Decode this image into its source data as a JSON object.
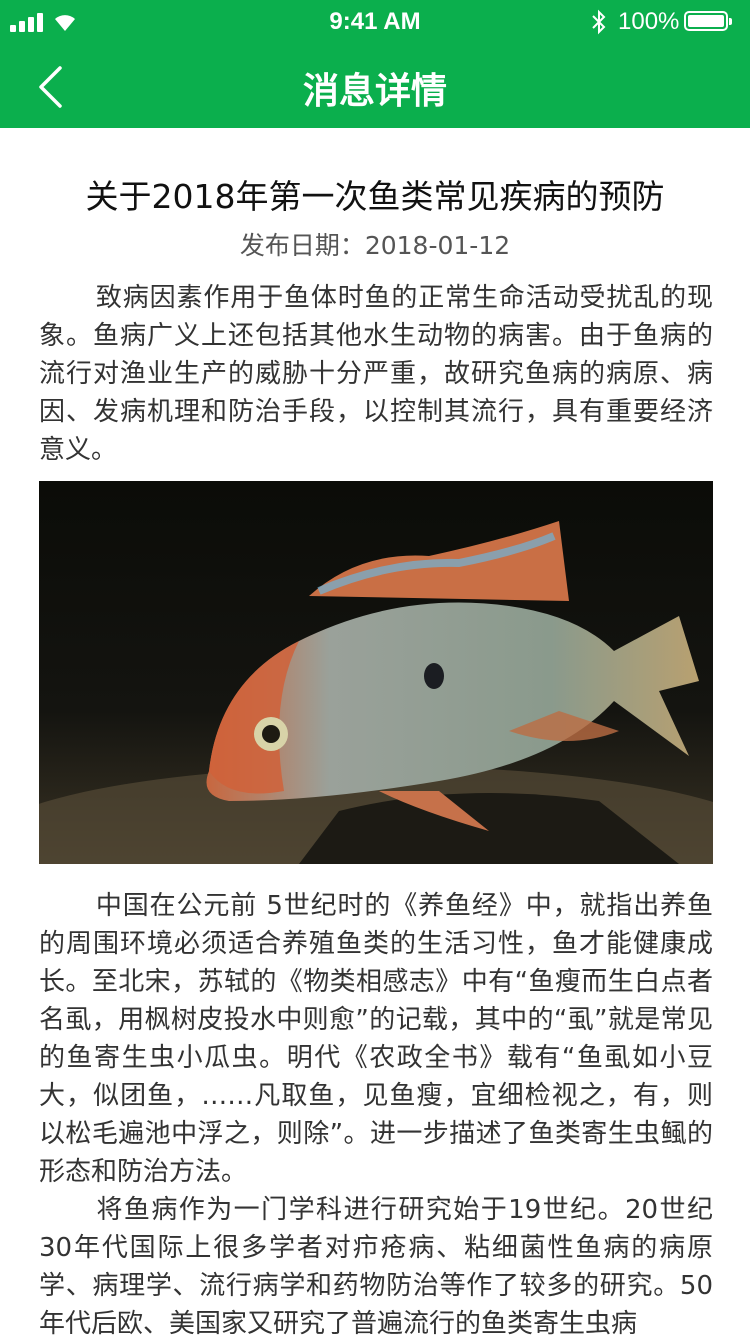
{
  "status_bar": {
    "time": "9:41 AM",
    "battery": "100%"
  },
  "nav": {
    "title": "消息详情"
  },
  "article": {
    "title": "关于2018年第一次鱼类常见疾病的预防",
    "date_label": "发布日期：2018-01-12",
    "paragraphs": [
      "致病因素作用于鱼体时鱼的正常生命活动受扰乱的现象。鱼病广义上还包括其他水生动物的病害。由于鱼病的流行对渔业生产的威胁十分严重，故研究鱼病的病原、病因、发病机理和防治手段，以控制其流行，具有重要经济意义。",
      "中国在公元前 5世纪时的《养鱼经》中，就指出养鱼的周围环境必须适合养殖鱼类的生活习性，鱼才能健康成长。至北宋，苏轼的《物类相感志》中有“鱼瘦而生白点者名虱，用枫树皮投水中则愈”的记载，其中的“虱”就是常见的鱼寄生虫小瓜虫。明代《农政全书》载有“鱼虱如小豆大，似团鱼，……凡取鱼，见鱼瘦，宜细检视之，有，则以松毛遍池中浮之，则除”。进一步描述了鱼类寄生虫鲺的形态和防治方法。",
      "将鱼病作为一门学科进行研究始于19世纪。20世纪30年代国际上很多学者对疖疮病、粘细菌性鱼病的病原学、病理学、流行病学和药物防治等作了较多的研究。50年代后欧、美国家又研究了普遍流行的鱼类寄生虫病"
    ]
  },
  "colors": {
    "accent": "#0BAF4D"
  }
}
